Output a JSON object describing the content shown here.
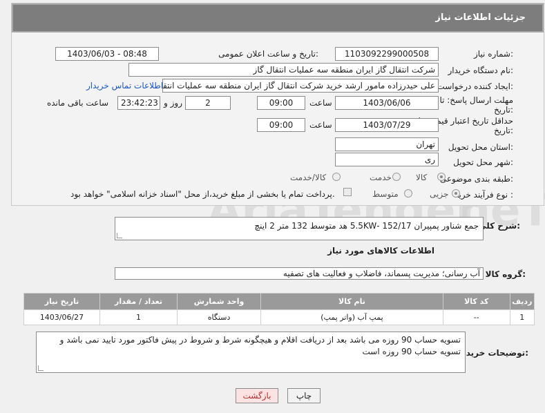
{
  "header": {
    "title": "جزئیات اطلاعات نیاز"
  },
  "form": {
    "need_number": {
      "label": "شماره نیاز:",
      "value": "1103092299000508"
    },
    "announce": {
      "label": "تاریخ و ساعت اعلان عمومی:",
      "value": "1403/06/03 - 08:48"
    },
    "buyer": {
      "label": "نام دستگاه خریدار:",
      "value": "شرکت انتقال گاز ایران منطقه سه عملیات انتقال گاز"
    },
    "creator": {
      "label": "ایجاد کننده درخواست:",
      "value": "علی حیدرزاده مامور ارشد خرید شرکت انتقال گاز ایران منطقه سه عملیات انتقال",
      "contact_link": "اطلاعات تماس خریدار"
    },
    "deadline": {
      "label_line1": "مهلت ارسال پاسخ: تا",
      "label_line2": "تاریخ:",
      "date": "1403/06/06",
      "time_label": "ساعت",
      "time": "09:00",
      "days": "2",
      "days_label": "روز و",
      "remaining": "23:42:23",
      "remaining_label": "ساعت باقی مانده"
    },
    "validity": {
      "label_line1": "حداقل تاریخ اعتبار قیمت: تا",
      "label_line2": "تاریخ:",
      "date": "1403/07/29",
      "time_label": "ساعت",
      "time": "09:00"
    },
    "province": {
      "label": "استان محل تحویل:",
      "value": "تهران"
    },
    "city": {
      "label": "شهر محل تحویل:",
      "value": "ری"
    },
    "category": {
      "label": "طبقه بندی موضوعی:",
      "options": [
        "کالا",
        "خدمت",
        "کالا/خدمت"
      ]
    },
    "process": {
      "label": "نوع فرآیند خرید :",
      "options": [
        "جزیی",
        "متوسط"
      ],
      "note": "پرداخت تمام یا بخشی از مبلغ خرید،از محل \"اسناد خزانه اسلامی\" خواهد بود."
    }
  },
  "need": {
    "label": "شرح کلی نیاز:",
    "value": "جمع شناور پمپیران 152/17 -5.5KW هد متوسط 132 متر 2 اینچ"
  },
  "goods_info": {
    "title": "اطلاعات کالاهای مورد نیاز",
    "group_label": "گروه کالا:",
    "group_value": "آب رسانی؛ مدیریت پسماند، فاضلاب و فعالیت های تصفیه"
  },
  "table": {
    "headers": [
      "ردیف",
      "کد کالا",
      "نام کالا",
      "واحد شمارش",
      "تعداد / مقدار",
      "تاریخ نیاز"
    ],
    "rows": [
      [
        "1",
        "--",
        "پمپ آب (واتر پمپ)",
        "دستگاه",
        "1",
        "1403/06/27"
      ]
    ]
  },
  "buyer_desc": {
    "label": "توضیحات خریدار:",
    "value": "تسویه حساب 90 روزه می باشد بعد از دریافت اقلام و هیچگونه شرط و شروط در پیش فاکتور مورد تایید نمی باشد و تسویه حساب 90 روزه است"
  },
  "buttons": {
    "print": "چاپ",
    "back": "بازگشت"
  },
  "watermark": {
    "text1": "AriaTender",
    "text2": ".neT"
  }
}
